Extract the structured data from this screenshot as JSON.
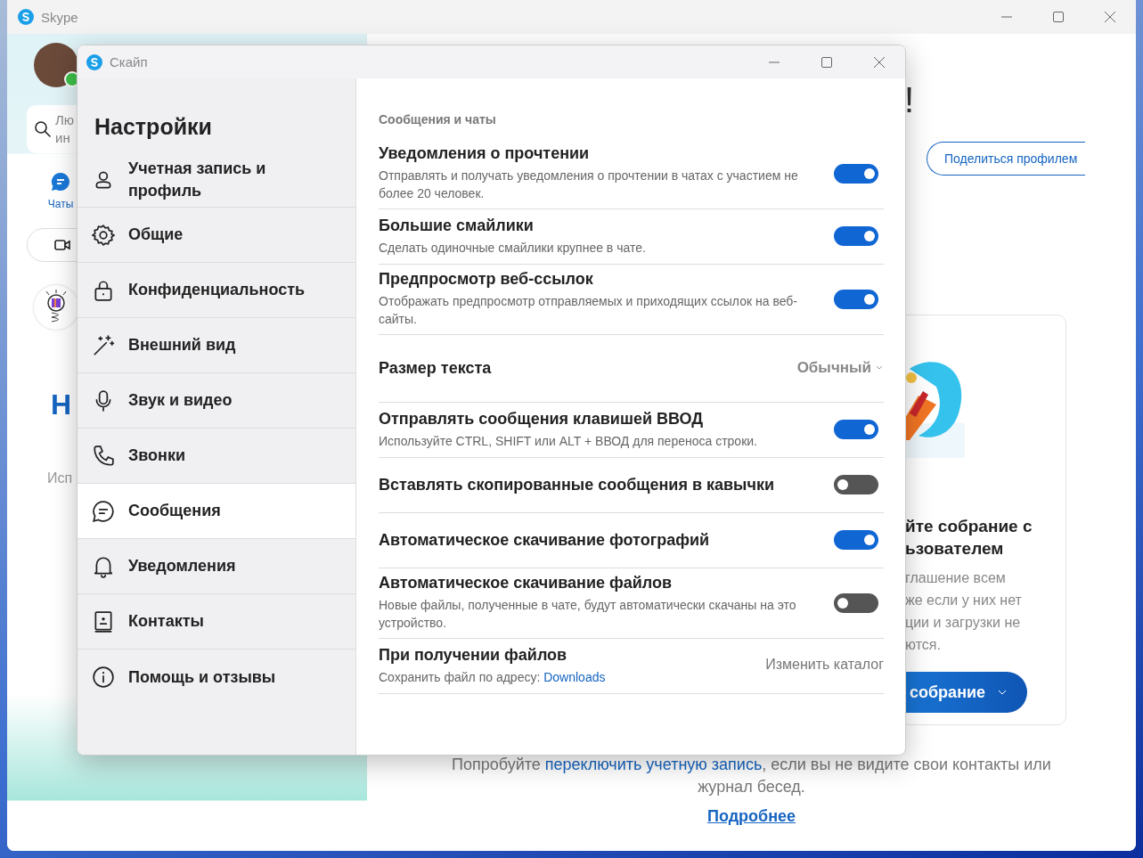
{
  "main_window": {
    "title": "Skype",
    "sidebar": {
      "online": true,
      "search": {
        "placeholder_lines": [
          "Лю",
          "ин"
        ]
      },
      "tabs": [
        {
          "label": "Чаты",
          "selected": true
        }
      ],
      "heading": "Н",
      "subtext": "Исп"
    },
    "greeting_end": "!",
    "share_button": "Поделиться профилем",
    "meeting_card": {
      "heading_lines": [
        "йте собрание с",
        "ьзователем"
      ],
      "body_lines": [
        "глашение всем",
        "же если у них нет",
        "ции и загрузки не",
        "ются."
      ],
      "button": "собрание"
    },
    "footer": {
      "before": "Попробуйте ",
      "link": "переключить учетную запись",
      "after": ", если вы не видите свои контакты или журнал бесед.",
      "more_link": "Подробнее"
    }
  },
  "settings_dialog": {
    "title": "Скайп",
    "heading": "Настройки",
    "nav": [
      {
        "label": "Учетная запись и профиль",
        "selected": false
      },
      {
        "label": "Общие",
        "selected": false
      },
      {
        "label": "Конфиденциальность",
        "selected": false
      },
      {
        "label": "Внешний вид",
        "selected": false
      },
      {
        "label": "Звук и видео",
        "selected": false
      },
      {
        "label": "Звонки",
        "selected": false
      },
      {
        "label": "Сообщения",
        "selected": true
      },
      {
        "label": "Уведомления",
        "selected": false
      },
      {
        "label": "Контакты",
        "selected": false
      },
      {
        "label": "Помощь и отзывы",
        "selected": false
      }
    ],
    "section": "Сообщения и чаты",
    "settings": [
      {
        "kind": "toggle",
        "title": "Уведомления о прочтении",
        "description": "Отправлять и получать уведомления о прочтении в чатах с участием не более 20 человек.",
        "on": true
      },
      {
        "kind": "toggle",
        "title": "Большие смайлики",
        "description": "Сделать одиночные смайлики крупнее в чате.",
        "on": true
      },
      {
        "kind": "toggle",
        "title": "Предпросмотр веб-ссылок",
        "description": "Отображать предпросмотр отправляемых и приходящих ссылок на веб-сайты.",
        "on": true
      },
      {
        "kind": "dropdown",
        "title": "Размер текста",
        "value": "Обычный"
      },
      {
        "kind": "toggle",
        "title": "Отправлять сообщения клавишей ВВОД",
        "description": "Используйте CTRL, SHIFT или ALT + ВВОД для переноса строки.",
        "on": true
      },
      {
        "kind": "toggle",
        "title": "Вставлять скопированные сообщения в кавычки",
        "on": false
      },
      {
        "kind": "toggle",
        "title": "Автоматическое скачивание фотографий",
        "on": true
      },
      {
        "kind": "toggle",
        "title": "Автоматическое скачивание файлов",
        "description": "Новые файлы, полученные в чате, будут автоматически скачаны на это устройство.",
        "on": false
      },
      {
        "kind": "folder",
        "title": "При получении файлов",
        "description": "Сохранить файл по адресу: ",
        "link": "Downloads",
        "action": "Изменить каталог"
      }
    ]
  }
}
